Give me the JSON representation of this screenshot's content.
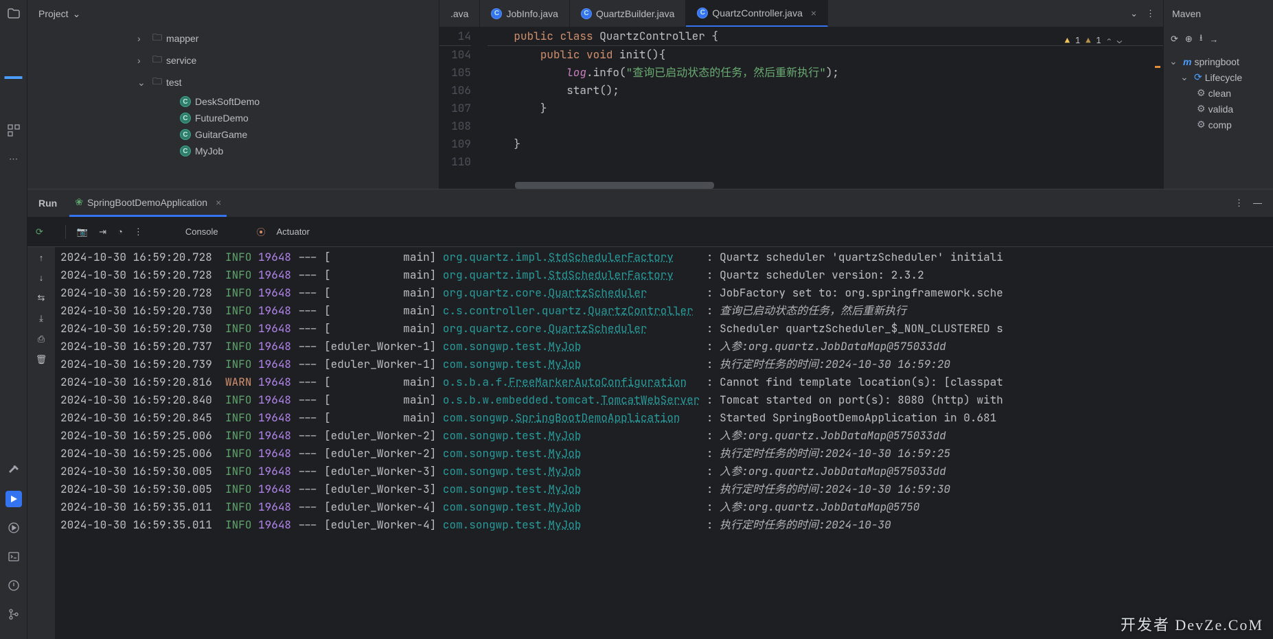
{
  "project": {
    "title": "Project",
    "tree": [
      {
        "type": "folder",
        "label": "mapper",
        "indent": 1,
        "chevron": "right"
      },
      {
        "type": "folder",
        "label": "service",
        "indent": 1,
        "chevron": "right"
      },
      {
        "type": "folder",
        "label": "test",
        "indent": 1,
        "chevron": "down"
      },
      {
        "type": "class",
        "label": "DeskSoftDemo",
        "indent": 2
      },
      {
        "type": "class",
        "label": "FutureDemo",
        "indent": 2
      },
      {
        "type": "class",
        "label": "GuitarGame",
        "indent": 2
      },
      {
        "type": "class",
        "label": "MyJob",
        "indent": 2
      }
    ]
  },
  "editor": {
    "tabs": [
      {
        "label": ".ava",
        "icon": false,
        "active": false,
        "truncated": true
      },
      {
        "label": "JobInfo.java",
        "icon": true,
        "active": false
      },
      {
        "label": "QuartzBuilder.java",
        "icon": true,
        "active": false
      },
      {
        "label": "QuartzController.java",
        "icon": true,
        "active": true,
        "closable": true
      }
    ],
    "inspections": [
      {
        "kind": "warn",
        "count": 1
      },
      {
        "kind": "weak",
        "count": 1
      }
    ],
    "sticky": {
      "num": 14,
      "indent": "    ",
      "tokens": [
        {
          "t": "public ",
          "c": "kw"
        },
        {
          "t": "class ",
          "c": "kw"
        },
        {
          "t": "QuartzController {",
          "c": "fn"
        }
      ]
    },
    "lines": [
      {
        "num": 104,
        "indent": "        ",
        "tokens": [
          {
            "t": "public ",
            "c": "kw"
          },
          {
            "t": "void ",
            "c": "kw"
          },
          {
            "t": "init(){",
            "c": "fn"
          }
        ]
      },
      {
        "num": 105,
        "indent": "            ",
        "tokens": [
          {
            "t": "log",
            "c": "field"
          },
          {
            "t": ".info(",
            "c": "fn"
          },
          {
            "t": "\"查询已启动状态的任务，然后重新执行\"",
            "c": "str"
          },
          {
            "t": ");",
            "c": "fn"
          }
        ]
      },
      {
        "num": 106,
        "indent": "            ",
        "tokens": [
          {
            "t": "start();",
            "c": "fn"
          }
        ]
      },
      {
        "num": 107,
        "indent": "        ",
        "tokens": [
          {
            "t": "}",
            "c": "fn"
          }
        ]
      },
      {
        "num": 108,
        "indent": "",
        "tokens": []
      },
      {
        "num": 109,
        "indent": "    ",
        "tokens": [
          {
            "t": "}",
            "c": "fn"
          }
        ]
      },
      {
        "num": 110,
        "indent": "",
        "tokens": []
      }
    ]
  },
  "maven": {
    "title": "Maven",
    "items": [
      {
        "label": "springboot",
        "indent": 0,
        "icon": "m",
        "chevron": "down"
      },
      {
        "label": "Lifecycle",
        "indent": 1,
        "icon": "cycle",
        "chevron": "down"
      },
      {
        "label": "clean",
        "indent": 2,
        "icon": "gear"
      },
      {
        "label": "valida",
        "indent": 2,
        "icon": "gear"
      },
      {
        "label": "comp",
        "indent": 2,
        "icon": "gear"
      }
    ]
  },
  "run": {
    "title": "Run",
    "tab": "SpringBootDemoApplication",
    "console_tab": "Console",
    "actuator_tab": "Actuator",
    "logs": [
      {
        "ts": "2024-10-30 16:59:20.728",
        "lv": "INFO",
        "pid": "19648",
        "thread": "[           main]",
        "pkg": "org.quartz.impl.",
        "cls": "StdSchedulerFactory",
        "msg": "Quartz scheduler 'quartzScheduler' initiali"
      },
      {
        "ts": "2024-10-30 16:59:20.728",
        "lv": "INFO",
        "pid": "19648",
        "thread": "[           main]",
        "pkg": "org.quartz.impl.",
        "cls": "StdSchedulerFactory",
        "msg": "Quartz scheduler version: 2.3.2"
      },
      {
        "ts": "2024-10-30 16:59:20.728",
        "lv": "INFO",
        "pid": "19648",
        "thread": "[           main]",
        "pkg": "org.quartz.core.",
        "cls": "QuartzScheduler",
        "msg": "JobFactory set to: org.springframework.sche"
      },
      {
        "ts": "2024-10-30 16:59:20.730",
        "lv": "INFO",
        "pid": "19648",
        "thread": "[           main]",
        "pkg": "c.s.controller.quartz.",
        "cls": "QuartzController",
        "msg_it": "查询已启动状态的任务，然后重新执行"
      },
      {
        "ts": "2024-10-30 16:59:20.730",
        "lv": "INFO",
        "pid": "19648",
        "thread": "[           main]",
        "pkg": "org.quartz.core.",
        "cls": "QuartzScheduler",
        "msg": "Scheduler quartzScheduler_$_NON_CLUSTERED s"
      },
      {
        "ts": "2024-10-30 16:59:20.737",
        "lv": "INFO",
        "pid": "19648",
        "thread": "[eduler_Worker-1]",
        "pkg": "com.songwp.test.",
        "cls": "MyJob",
        "msg_it": "入参:org.quartz.JobDataMap@575033dd"
      },
      {
        "ts": "2024-10-30 16:59:20.739",
        "lv": "INFO",
        "pid": "19648",
        "thread": "[eduler_Worker-1]",
        "pkg": "com.songwp.test.",
        "cls": "MyJob",
        "msg_it": "执行定时任务的时间:2024-10-30 16:59:20"
      },
      {
        "ts": "2024-10-30 16:59:20.816",
        "lv": "WARN",
        "pid": "19648",
        "thread": "[           main]",
        "pkg": "o.s.b.a.f.",
        "cls": "FreeMarkerAutoConfiguration",
        "msg": "Cannot find template location(s): [classpat"
      },
      {
        "ts": "2024-10-30 16:59:20.840",
        "lv": "INFO",
        "pid": "19648",
        "thread": "[           main]",
        "pkg": "o.s.b.w.embedded.tomcat.",
        "cls": "TomcatWebServer",
        "msg": "Tomcat started on port(s): 8080 (http) with"
      },
      {
        "ts": "2024-10-30 16:59:20.845",
        "lv": "INFO",
        "pid": "19648",
        "thread": "[           main]",
        "pkg": "com.songwp.",
        "cls": "SpringBootDemoApplication",
        "msg": "Started SpringBootDemoApplication in 0.681"
      },
      {
        "ts": "2024-10-30 16:59:25.006",
        "lv": "INFO",
        "pid": "19648",
        "thread": "[eduler_Worker-2]",
        "pkg": "com.songwp.test.",
        "cls": "MyJob",
        "msg_it": "入参:org.quartz.JobDataMap@575033dd"
      },
      {
        "ts": "2024-10-30 16:59:25.006",
        "lv": "INFO",
        "pid": "19648",
        "thread": "[eduler_Worker-2]",
        "pkg": "com.songwp.test.",
        "cls": "MyJob",
        "msg_it": "执行定时任务的时间:2024-10-30 16:59:25"
      },
      {
        "ts": "2024-10-30 16:59:30.005",
        "lv": "INFO",
        "pid": "19648",
        "thread": "[eduler_Worker-3]",
        "pkg": "com.songwp.test.",
        "cls": "MyJob",
        "msg_it": "入参:org.quartz.JobDataMap@575033dd"
      },
      {
        "ts": "2024-10-30 16:59:30.005",
        "lv": "INFO",
        "pid": "19648",
        "thread": "[eduler_Worker-3]",
        "pkg": "com.songwp.test.",
        "cls": "MyJob",
        "msg_it": "执行定时任务的时间:2024-10-30 16:59:30"
      },
      {
        "ts": "2024-10-30 16:59:35.011",
        "lv": "INFO",
        "pid": "19648",
        "thread": "[eduler_Worker-4]",
        "pkg": "com.songwp.test.",
        "cls": "MyJob",
        "msg_it": "入参:org.quartz.JobDataMap@5750"
      },
      {
        "ts": "2024-10-30 16:59:35.011",
        "lv": "INFO",
        "pid": "19648",
        "thread": "[eduler_Worker-4]",
        "pkg": "com.songwp.test.",
        "cls": "MyJob",
        "msg_it": "执行定时任务的时间:2024-10-30"
      }
    ]
  },
  "watermark": "开发者 DevZe.CoM"
}
